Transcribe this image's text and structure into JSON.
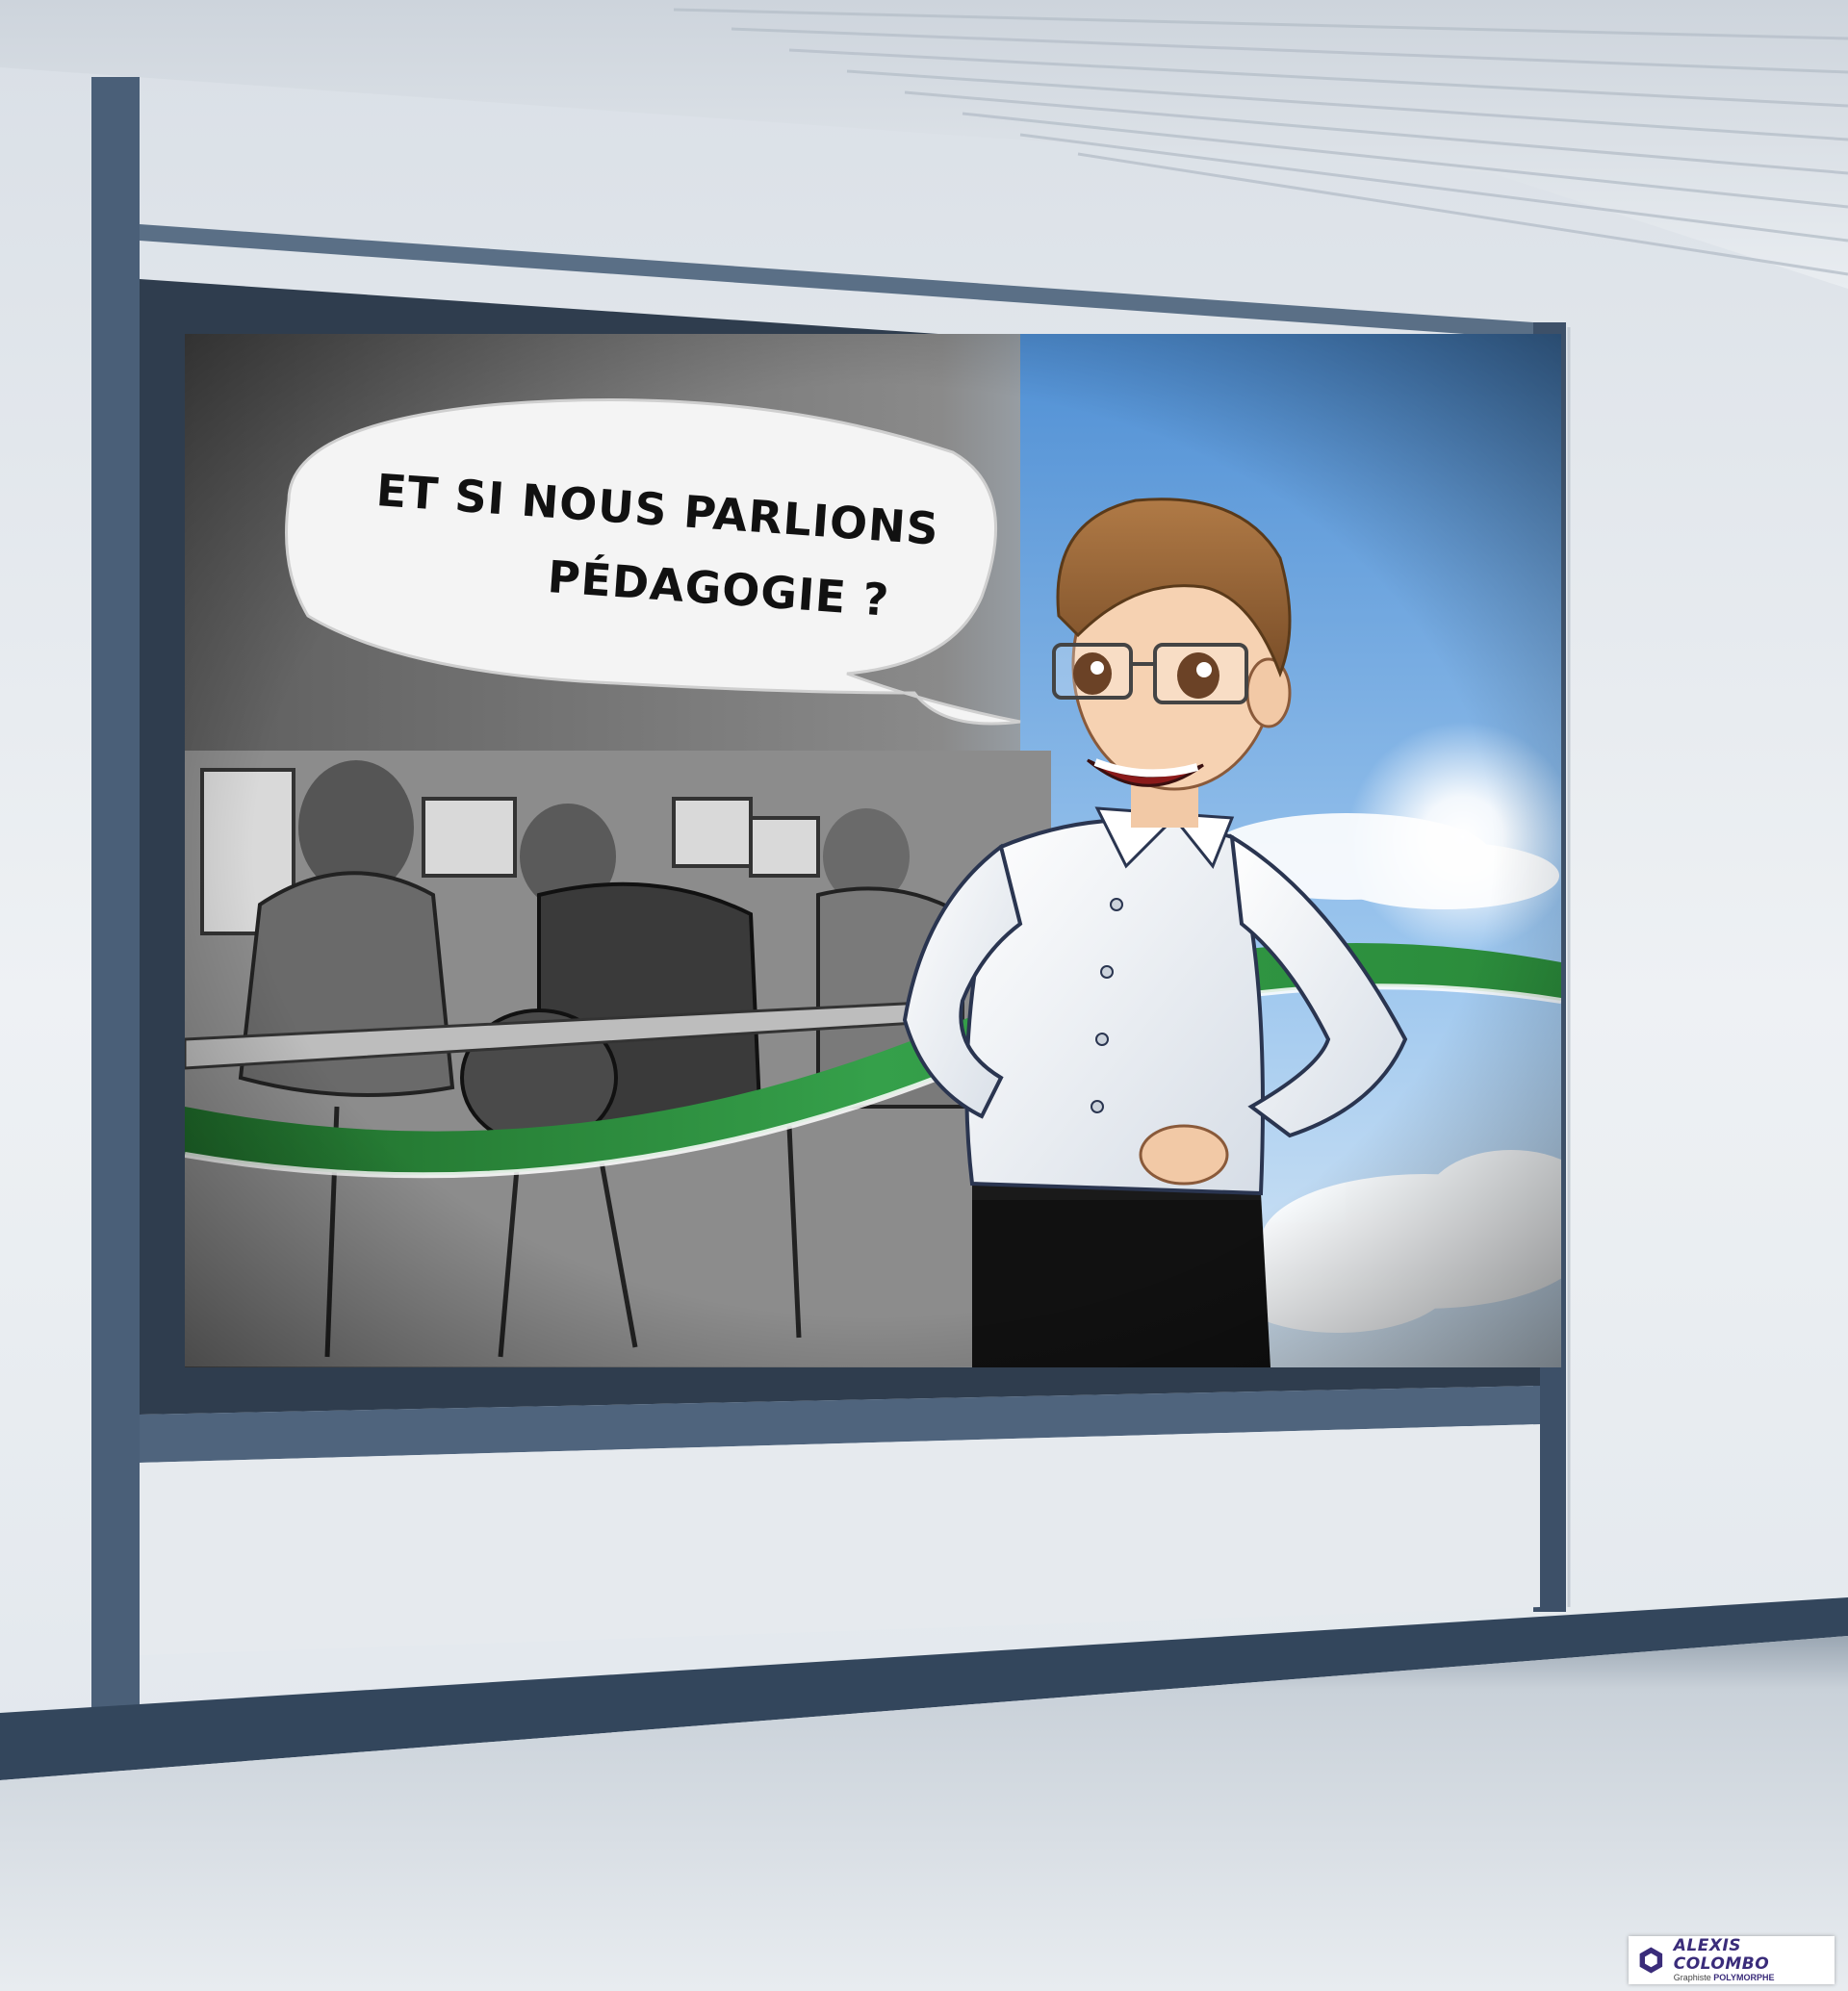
{
  "billboard": {
    "speech_line1": "ET SI NOUS PARLIONS",
    "speech_line2": "PÉDAGOGIE ?"
  },
  "credit": {
    "name": "ALEXIS COLOMBO",
    "role_prefix": "Graphiste",
    "role_highlight": "POLYMORPHE"
  },
  "colors": {
    "wall": "#e3e8ee",
    "frame": "#4a5f78",
    "floor": "#c7cfd7",
    "accent_green": "#2e8b3c",
    "sky": "#7fb4e6"
  }
}
